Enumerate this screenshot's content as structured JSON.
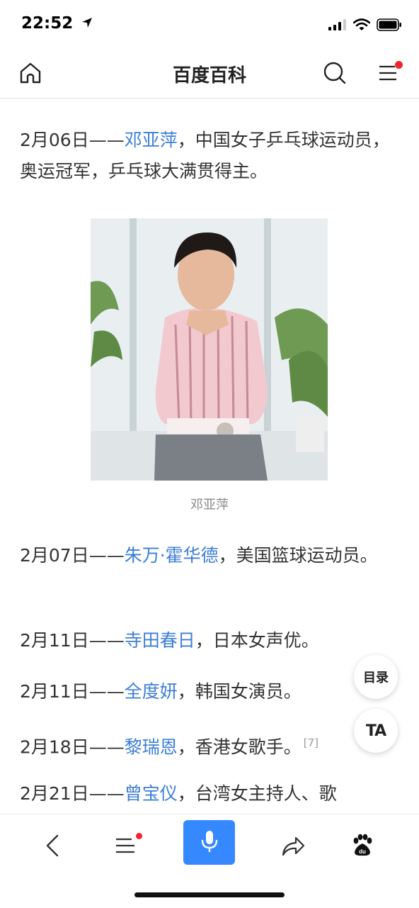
{
  "status": {
    "time": "22:52"
  },
  "header": {
    "title": "百度百科"
  },
  "entries": [
    {
      "date": "2月06日——",
      "name": "邓亚萍",
      "desc": "，中国女子乒乓球运动员，奥运冠军，乒乓球大满贯得主。"
    },
    {
      "date": "2月07日——",
      "name": "朱万·霍华德",
      "desc": "，美国篮球运动员。"
    },
    {
      "date": "2月11日——",
      "name": "寺田春日",
      "desc": "，日本女声优。"
    },
    {
      "date": "2月11日——",
      "name": "全度妍",
      "desc": "，韩国女演员。"
    },
    {
      "date": "2月18日——",
      "name": "黎瑞恩",
      "desc": "，香港女歌手。",
      "ref": "[7]"
    },
    {
      "date": "2月21日——",
      "name": "曾宝仪",
      "desc": "，台湾女主持人、歌"
    }
  ],
  "image": {
    "caption": "邓亚萍"
  },
  "floating": {
    "toc_label": "目录",
    "ta_label": "TA"
  },
  "colors": {
    "link": "#3d7ed6",
    "accent": "#3688ff",
    "badge": "#f5222d"
  },
  "icons": [
    "home-icon",
    "search-icon",
    "menu-icon",
    "back-icon",
    "list-icon",
    "microphone-icon",
    "share-icon",
    "baidu-paw-icon"
  ]
}
